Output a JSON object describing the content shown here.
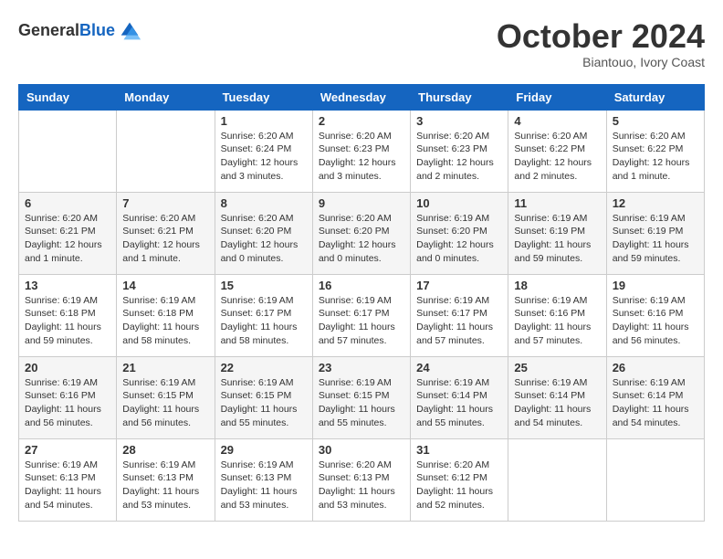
{
  "logo": {
    "general": "General",
    "blue": "Blue"
  },
  "header": {
    "month": "October 2024",
    "location": "Biantouo, Ivory Coast"
  },
  "weekdays": [
    "Sunday",
    "Monday",
    "Tuesday",
    "Wednesday",
    "Thursday",
    "Friday",
    "Saturday"
  ],
  "weeks": [
    [
      {
        "day": "",
        "info": ""
      },
      {
        "day": "",
        "info": ""
      },
      {
        "day": "1",
        "info": "Sunrise: 6:20 AM\nSunset: 6:24 PM\nDaylight: 12 hours and 3 minutes."
      },
      {
        "day": "2",
        "info": "Sunrise: 6:20 AM\nSunset: 6:23 PM\nDaylight: 12 hours and 3 minutes."
      },
      {
        "day": "3",
        "info": "Sunrise: 6:20 AM\nSunset: 6:23 PM\nDaylight: 12 hours and 2 minutes."
      },
      {
        "day": "4",
        "info": "Sunrise: 6:20 AM\nSunset: 6:22 PM\nDaylight: 12 hours and 2 minutes."
      },
      {
        "day": "5",
        "info": "Sunrise: 6:20 AM\nSunset: 6:22 PM\nDaylight: 12 hours and 1 minute."
      }
    ],
    [
      {
        "day": "6",
        "info": "Sunrise: 6:20 AM\nSunset: 6:21 PM\nDaylight: 12 hours and 1 minute."
      },
      {
        "day": "7",
        "info": "Sunrise: 6:20 AM\nSunset: 6:21 PM\nDaylight: 12 hours and 1 minute."
      },
      {
        "day": "8",
        "info": "Sunrise: 6:20 AM\nSunset: 6:20 PM\nDaylight: 12 hours and 0 minutes."
      },
      {
        "day": "9",
        "info": "Sunrise: 6:20 AM\nSunset: 6:20 PM\nDaylight: 12 hours and 0 minutes."
      },
      {
        "day": "10",
        "info": "Sunrise: 6:19 AM\nSunset: 6:20 PM\nDaylight: 12 hours and 0 minutes."
      },
      {
        "day": "11",
        "info": "Sunrise: 6:19 AM\nSunset: 6:19 PM\nDaylight: 11 hours and 59 minutes."
      },
      {
        "day": "12",
        "info": "Sunrise: 6:19 AM\nSunset: 6:19 PM\nDaylight: 11 hours and 59 minutes."
      }
    ],
    [
      {
        "day": "13",
        "info": "Sunrise: 6:19 AM\nSunset: 6:18 PM\nDaylight: 11 hours and 59 minutes."
      },
      {
        "day": "14",
        "info": "Sunrise: 6:19 AM\nSunset: 6:18 PM\nDaylight: 11 hours and 58 minutes."
      },
      {
        "day": "15",
        "info": "Sunrise: 6:19 AM\nSunset: 6:17 PM\nDaylight: 11 hours and 58 minutes."
      },
      {
        "day": "16",
        "info": "Sunrise: 6:19 AM\nSunset: 6:17 PM\nDaylight: 11 hours and 57 minutes."
      },
      {
        "day": "17",
        "info": "Sunrise: 6:19 AM\nSunset: 6:17 PM\nDaylight: 11 hours and 57 minutes."
      },
      {
        "day": "18",
        "info": "Sunrise: 6:19 AM\nSunset: 6:16 PM\nDaylight: 11 hours and 57 minutes."
      },
      {
        "day": "19",
        "info": "Sunrise: 6:19 AM\nSunset: 6:16 PM\nDaylight: 11 hours and 56 minutes."
      }
    ],
    [
      {
        "day": "20",
        "info": "Sunrise: 6:19 AM\nSunset: 6:16 PM\nDaylight: 11 hours and 56 minutes."
      },
      {
        "day": "21",
        "info": "Sunrise: 6:19 AM\nSunset: 6:15 PM\nDaylight: 11 hours and 56 minutes."
      },
      {
        "day": "22",
        "info": "Sunrise: 6:19 AM\nSunset: 6:15 PM\nDaylight: 11 hours and 55 minutes."
      },
      {
        "day": "23",
        "info": "Sunrise: 6:19 AM\nSunset: 6:15 PM\nDaylight: 11 hours and 55 minutes."
      },
      {
        "day": "24",
        "info": "Sunrise: 6:19 AM\nSunset: 6:14 PM\nDaylight: 11 hours and 55 minutes."
      },
      {
        "day": "25",
        "info": "Sunrise: 6:19 AM\nSunset: 6:14 PM\nDaylight: 11 hours and 54 minutes."
      },
      {
        "day": "26",
        "info": "Sunrise: 6:19 AM\nSunset: 6:14 PM\nDaylight: 11 hours and 54 minutes."
      }
    ],
    [
      {
        "day": "27",
        "info": "Sunrise: 6:19 AM\nSunset: 6:13 PM\nDaylight: 11 hours and 54 minutes."
      },
      {
        "day": "28",
        "info": "Sunrise: 6:19 AM\nSunset: 6:13 PM\nDaylight: 11 hours and 53 minutes."
      },
      {
        "day": "29",
        "info": "Sunrise: 6:19 AM\nSunset: 6:13 PM\nDaylight: 11 hours and 53 minutes."
      },
      {
        "day": "30",
        "info": "Sunrise: 6:20 AM\nSunset: 6:13 PM\nDaylight: 11 hours and 53 minutes."
      },
      {
        "day": "31",
        "info": "Sunrise: 6:20 AM\nSunset: 6:12 PM\nDaylight: 11 hours and 52 minutes."
      },
      {
        "day": "",
        "info": ""
      },
      {
        "day": "",
        "info": ""
      }
    ]
  ]
}
